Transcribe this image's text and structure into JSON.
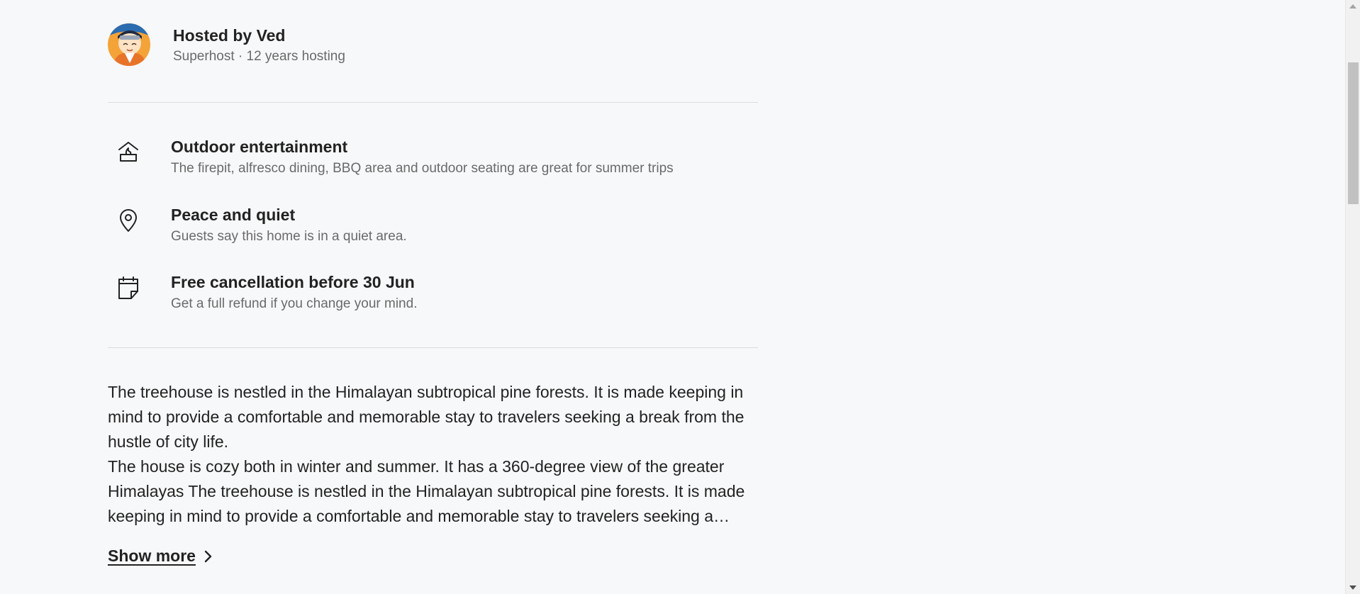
{
  "host": {
    "name": "Hosted by Ved",
    "subtitle": "Superhost · 12 years hosting",
    "avatar_icon": "host-avatar"
  },
  "highlights": [
    {
      "icon": "firepit-icon",
      "title": "Outdoor entertainment",
      "description": "The firepit, alfresco dining, BBQ area and outdoor seating are great for summer trips"
    },
    {
      "icon": "location-pin-icon",
      "title": "Peace and quiet",
      "description": "Guests say this home is in a quiet area."
    },
    {
      "icon": "calendar-icon",
      "title": "Free cancellation before 30 Jun",
      "description": "Get a full refund if you change your mind."
    }
  ],
  "description": {
    "paragraph1": "The treehouse is nestled in the Himalayan subtropical pine forests. It is made keeping in mind to provide a comfortable and memorable stay to travelers seeking a break from the hustle of city life.",
    "paragraph2": "The house is cozy both in winter and summer. It has a 360-degree view of the greater Himalayas The treehouse is nestled in the Himalayan subtropical pine forests. It is made keeping in mind to provide a comfortable and memorable stay to travelers seeking a break from the hustle of city life."
  },
  "show_more": {
    "label": "Show more",
    "icon": "chevron-right-icon"
  },
  "colors": {
    "background": "#f7f8fa",
    "text_primary": "#222222",
    "text_secondary": "#6a6a6a",
    "divider": "#dddddd"
  }
}
